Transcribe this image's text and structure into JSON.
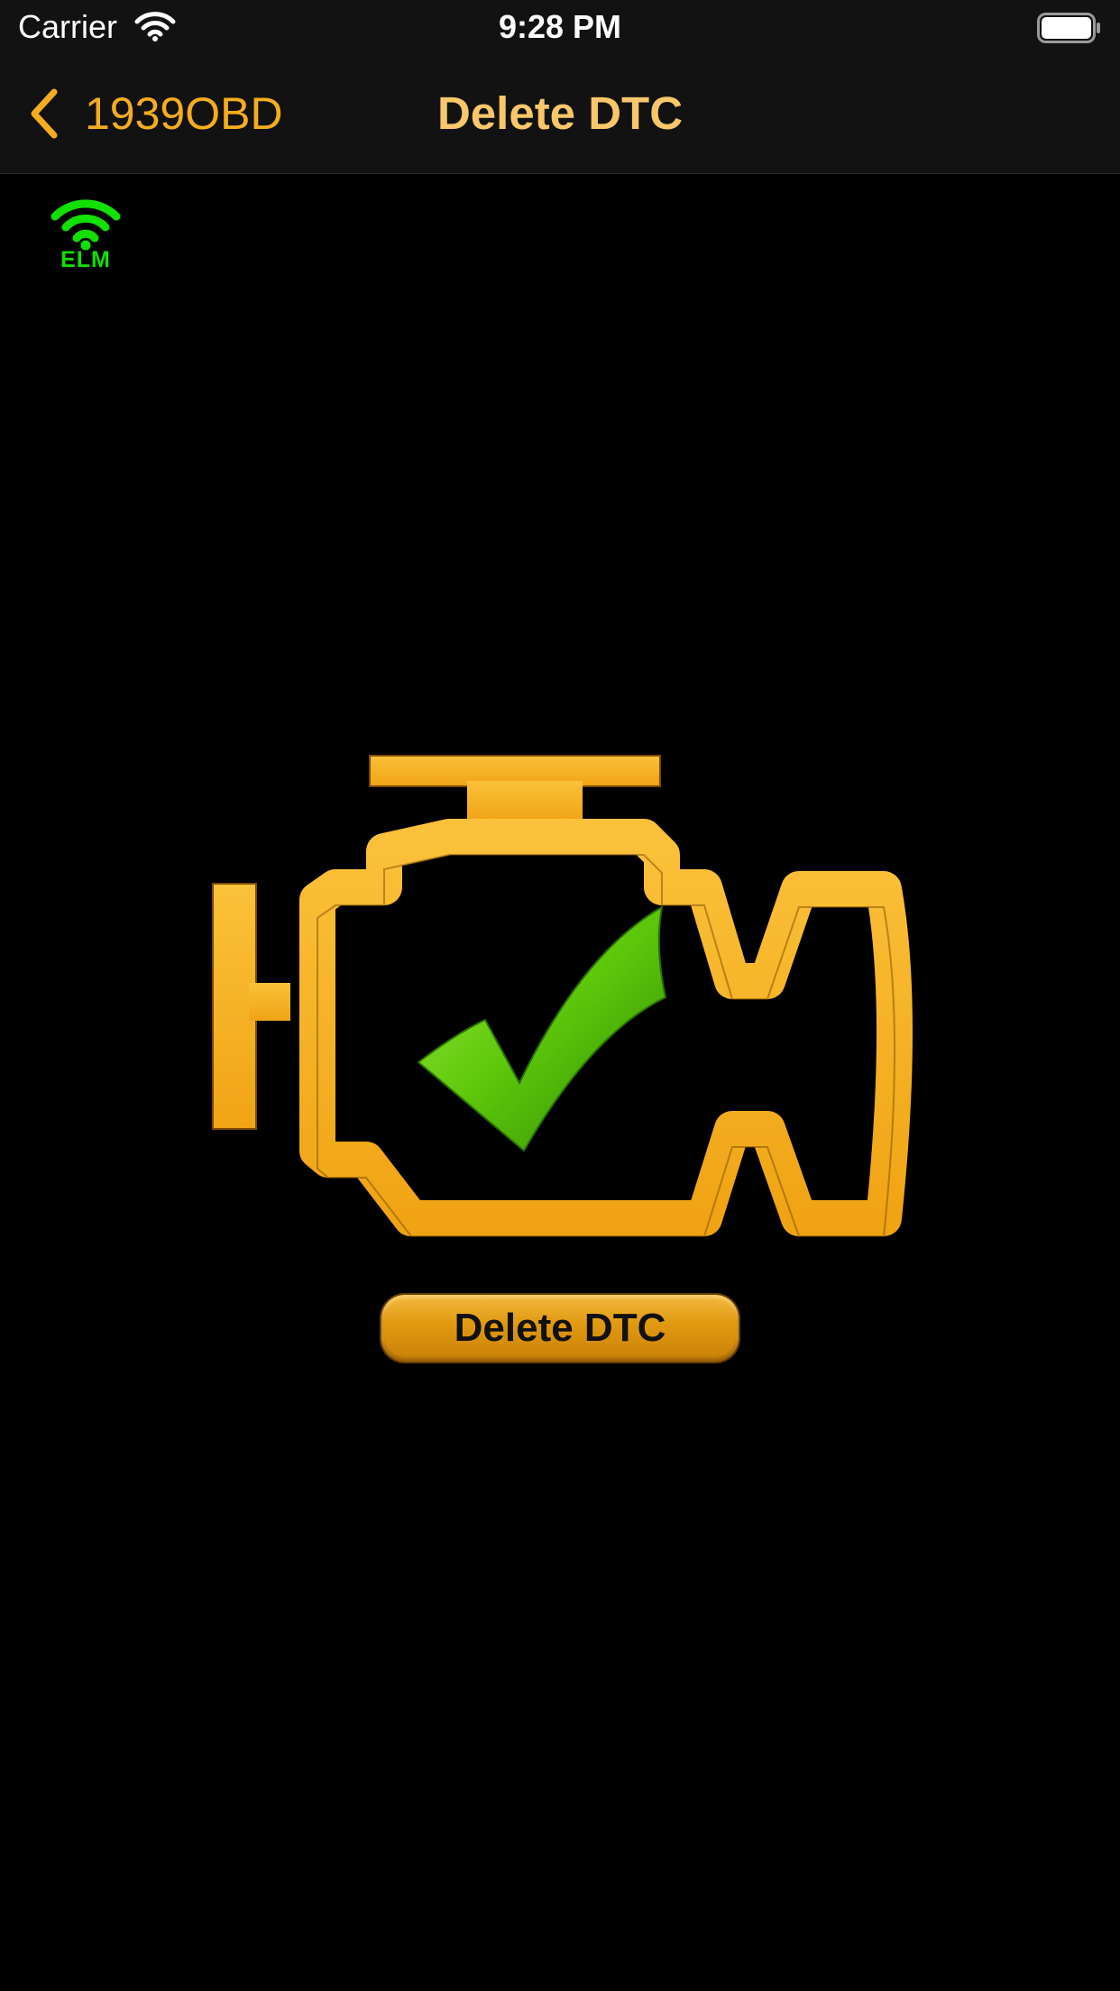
{
  "status_bar": {
    "carrier": "Carrier",
    "time": "9:28 PM"
  },
  "nav": {
    "back_label": "1939OBD",
    "title": "Delete DTC"
  },
  "connection": {
    "label": "ELM",
    "icon": "wifi-icon",
    "color": "#11e000"
  },
  "main": {
    "engine_icon": "check-engine-ok-icon",
    "delete_button_label": "Delete DTC"
  },
  "colors": {
    "accent": "#f5ad1e",
    "title": "#f9c76a",
    "check": "#5cc70a",
    "background": "#000000"
  }
}
